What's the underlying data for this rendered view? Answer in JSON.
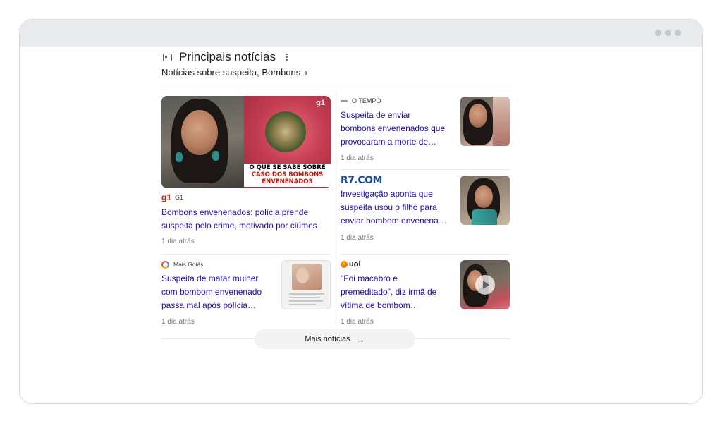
{
  "section": {
    "title": "Principais notícias",
    "subtitle": "Notícias sobre suspeita, Bombons",
    "subtitle_chevron": "›"
  },
  "cards": [
    {
      "source": "G1",
      "source_logo": "g1",
      "overlay_line1": "O QUE SE SABE SOBRE",
      "overlay_line2": "CASO DOS BOMBONS",
      "overlay_line3": "ENVENENADOS",
      "watermark": "g1",
      "title": "Bombons envenenados: polícia prende suspeita pelo crime, motivado por ciúmes",
      "time": "1 dia atrás"
    },
    {
      "source": "O TEMPO",
      "title": "Suspeita de enviar bombons envenenados que provocaram a morte de…",
      "time": "1 dia atrás"
    },
    {
      "source_logo": "R7.COM",
      "title": "Investigação aponta que suspeita usou o filho para enviar bombom envenena…",
      "time": "1 dia atrás"
    },
    {
      "source": "Mais Goiás",
      "title": "Suspeita de matar mulher com bombom envenenado passa mal após polícia…",
      "time": "1 dia atrás"
    },
    {
      "source_logo": "uol",
      "title": "\"Foi macabro e premeditado\", diz irmã de vítima de bombom…",
      "time": "1 dia atrás"
    }
  ],
  "more_button": {
    "label": "Mais notícias",
    "icon": "arrow-right-icon"
  },
  "colors": {
    "link": "#1a0dab",
    "g1_red": "#c4170c",
    "r7_blue": "#1a4a9c",
    "uol_orange": "#f8b400"
  }
}
